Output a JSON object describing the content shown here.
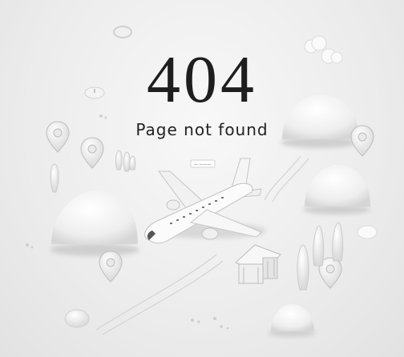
{
  "error": {
    "code": "404",
    "message": "Page not found"
  },
  "plane_tag": {
    "label": "— ———"
  },
  "icons": [
    "location-pin-icon",
    "airplane-icon",
    "cloud-icon",
    "house-icon",
    "tree-icon",
    "hill-icon"
  ]
}
